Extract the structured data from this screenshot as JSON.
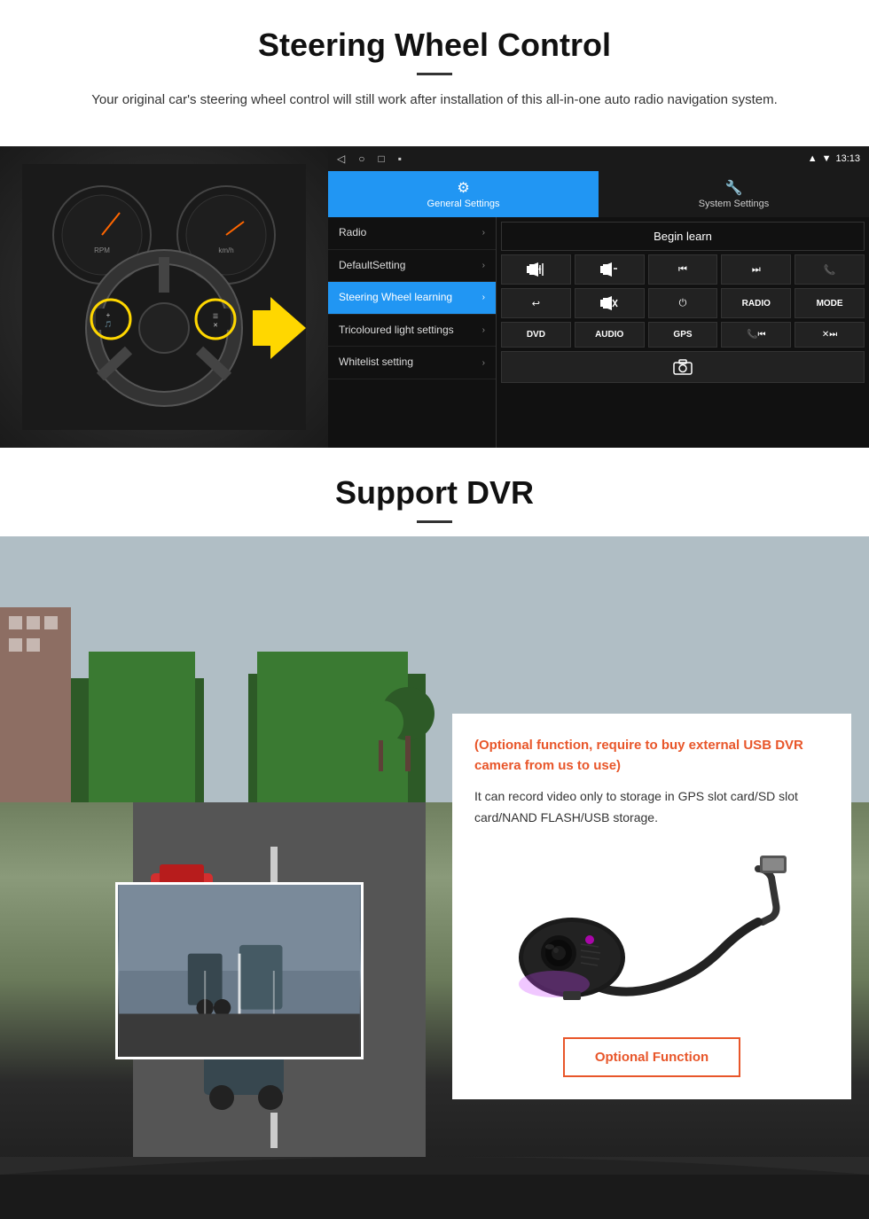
{
  "page": {
    "section1": {
      "title": "Steering Wheel Control",
      "description": "Your original car's steering wheel control will still work after installation of this all-in-one auto radio navigation system.",
      "statusbar": {
        "time": "13:13",
        "nav_back": "◁",
        "nav_home": "○",
        "nav_recent": "□",
        "nav_menu": "▪"
      },
      "tabs": {
        "general": {
          "icon": "⚙",
          "label": "General Settings"
        },
        "system": {
          "icon": "🔧",
          "label": "System Settings"
        }
      },
      "menu_items": [
        {
          "label": "Radio",
          "active": false
        },
        {
          "label": "DefaultSetting",
          "active": false
        },
        {
          "label": "Steering Wheel learning",
          "active": true
        },
        {
          "label": "Tricoloured light settings",
          "active": false
        },
        {
          "label": "Whitelist setting",
          "active": false
        }
      ],
      "begin_learn": "Begin learn",
      "control_buttons": {
        "row1": [
          "⏮+",
          "⏮-",
          "⏮⏮",
          "⏭⏭",
          "📞"
        ],
        "row2": [
          "↩",
          "🔇",
          "⏻",
          "RADIO",
          "MODE"
        ],
        "row3": [
          "DVD",
          "AUDIO",
          "GPS",
          "📞⏮",
          "✕⏭"
        ],
        "row4": [
          "📷"
        ]
      }
    },
    "section2": {
      "title": "Support DVR",
      "card": {
        "optional_text": "(Optional function, require to buy external USB DVR camera from us to use)",
        "description": "It can record video only to storage in GPS slot card/SD slot card/NAND FLASH/USB storage.",
        "button_label": "Optional Function"
      }
    }
  }
}
